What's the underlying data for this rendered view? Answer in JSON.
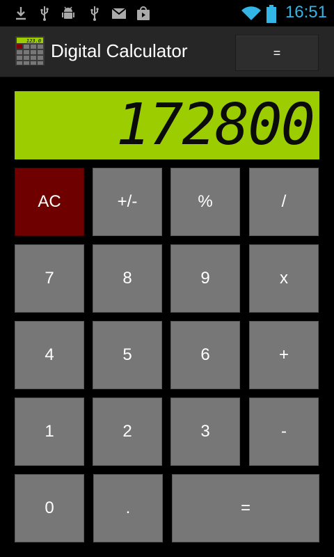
{
  "status_bar": {
    "time": "16:51",
    "icons": [
      "download-icon",
      "usb-icon",
      "android-debug-icon",
      "usb-icon",
      "gmail-icon",
      "play-store-icon",
      "wifi-icon",
      "battery-icon"
    ]
  },
  "action_bar": {
    "title": "Digital Calculator",
    "app_icon_display": "123.0",
    "action_label": "="
  },
  "display": {
    "value": "172800",
    "color": "#9ccd00"
  },
  "keys": {
    "ac": "AC",
    "sign": "+/-",
    "percent": "%",
    "divide": "/",
    "seven": "7",
    "eight": "8",
    "nine": "9",
    "multiply": "x",
    "four": "4",
    "five": "5",
    "six": "6",
    "plus": "+",
    "one": "1",
    "two": "2",
    "three": "3",
    "minus": "-",
    "zero": "0",
    "dot": ".",
    "equals": "="
  },
  "colors": {
    "accent": "#33b5e5",
    "key": "#777777",
    "clear_key": "#6e0000"
  }
}
